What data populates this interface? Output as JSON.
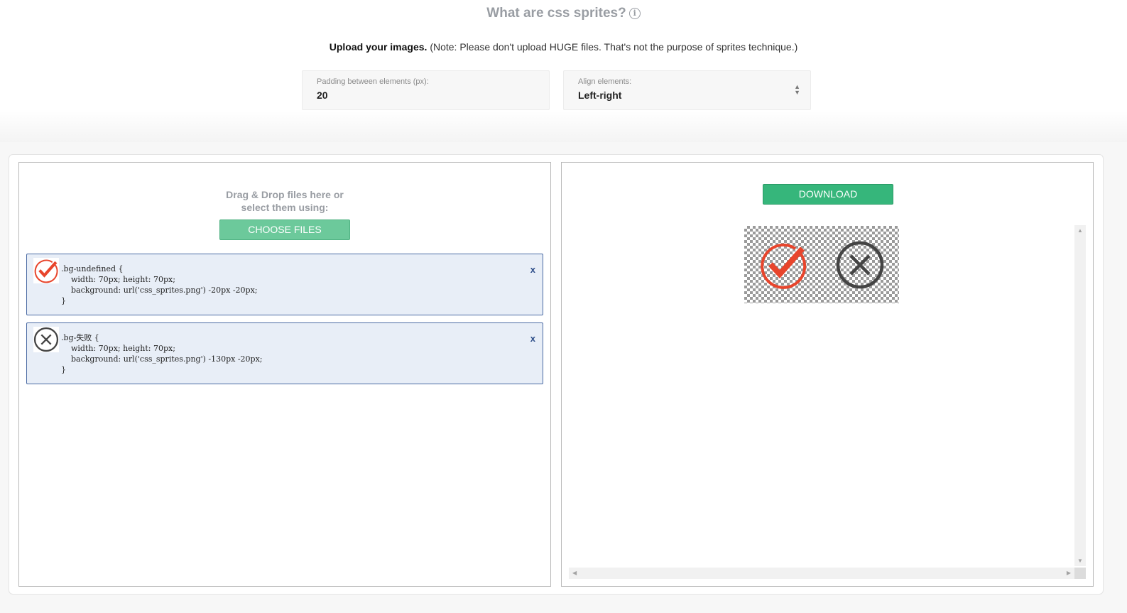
{
  "header": {
    "title": "What are css sprites?",
    "info_icon": "i",
    "upload_bold": "Upload your images.",
    "upload_note": " (Note: Please don't upload HUGE files. That's not the purpose of sprites technique.)"
  },
  "settings": {
    "padding_label": "Padding between elements (px):",
    "padding_value": "20",
    "align_label": "Align elements:",
    "align_value": "Left-right"
  },
  "left_panel": {
    "dnd_line1": "Drag & Drop files here or",
    "dnd_line2": "select them using:",
    "choose_label": "CHOOSE FILES",
    "items": [
      {
        "icon": "check-circle-icon",
        "code": ".bg-undefined {\n    width: 70px; height: 70px;\n    background: url('css_sprites.png') -20px -20px;\n}",
        "remove": "x"
      },
      {
        "icon": "x-circle-icon",
        "code": ".bg-失败 {\n    width: 70px; height: 70px;\n    background: url('css_sprites.png') -130px -20px;\n}",
        "remove": "x"
      }
    ]
  },
  "right_panel": {
    "download_label": "DOWNLOAD"
  },
  "colors": {
    "check_red": "#e8452c",
    "x_dark": "#444444",
    "button_green": "#6cc99b",
    "download_green": "#36b67b",
    "item_border": "#4a6aa3"
  }
}
